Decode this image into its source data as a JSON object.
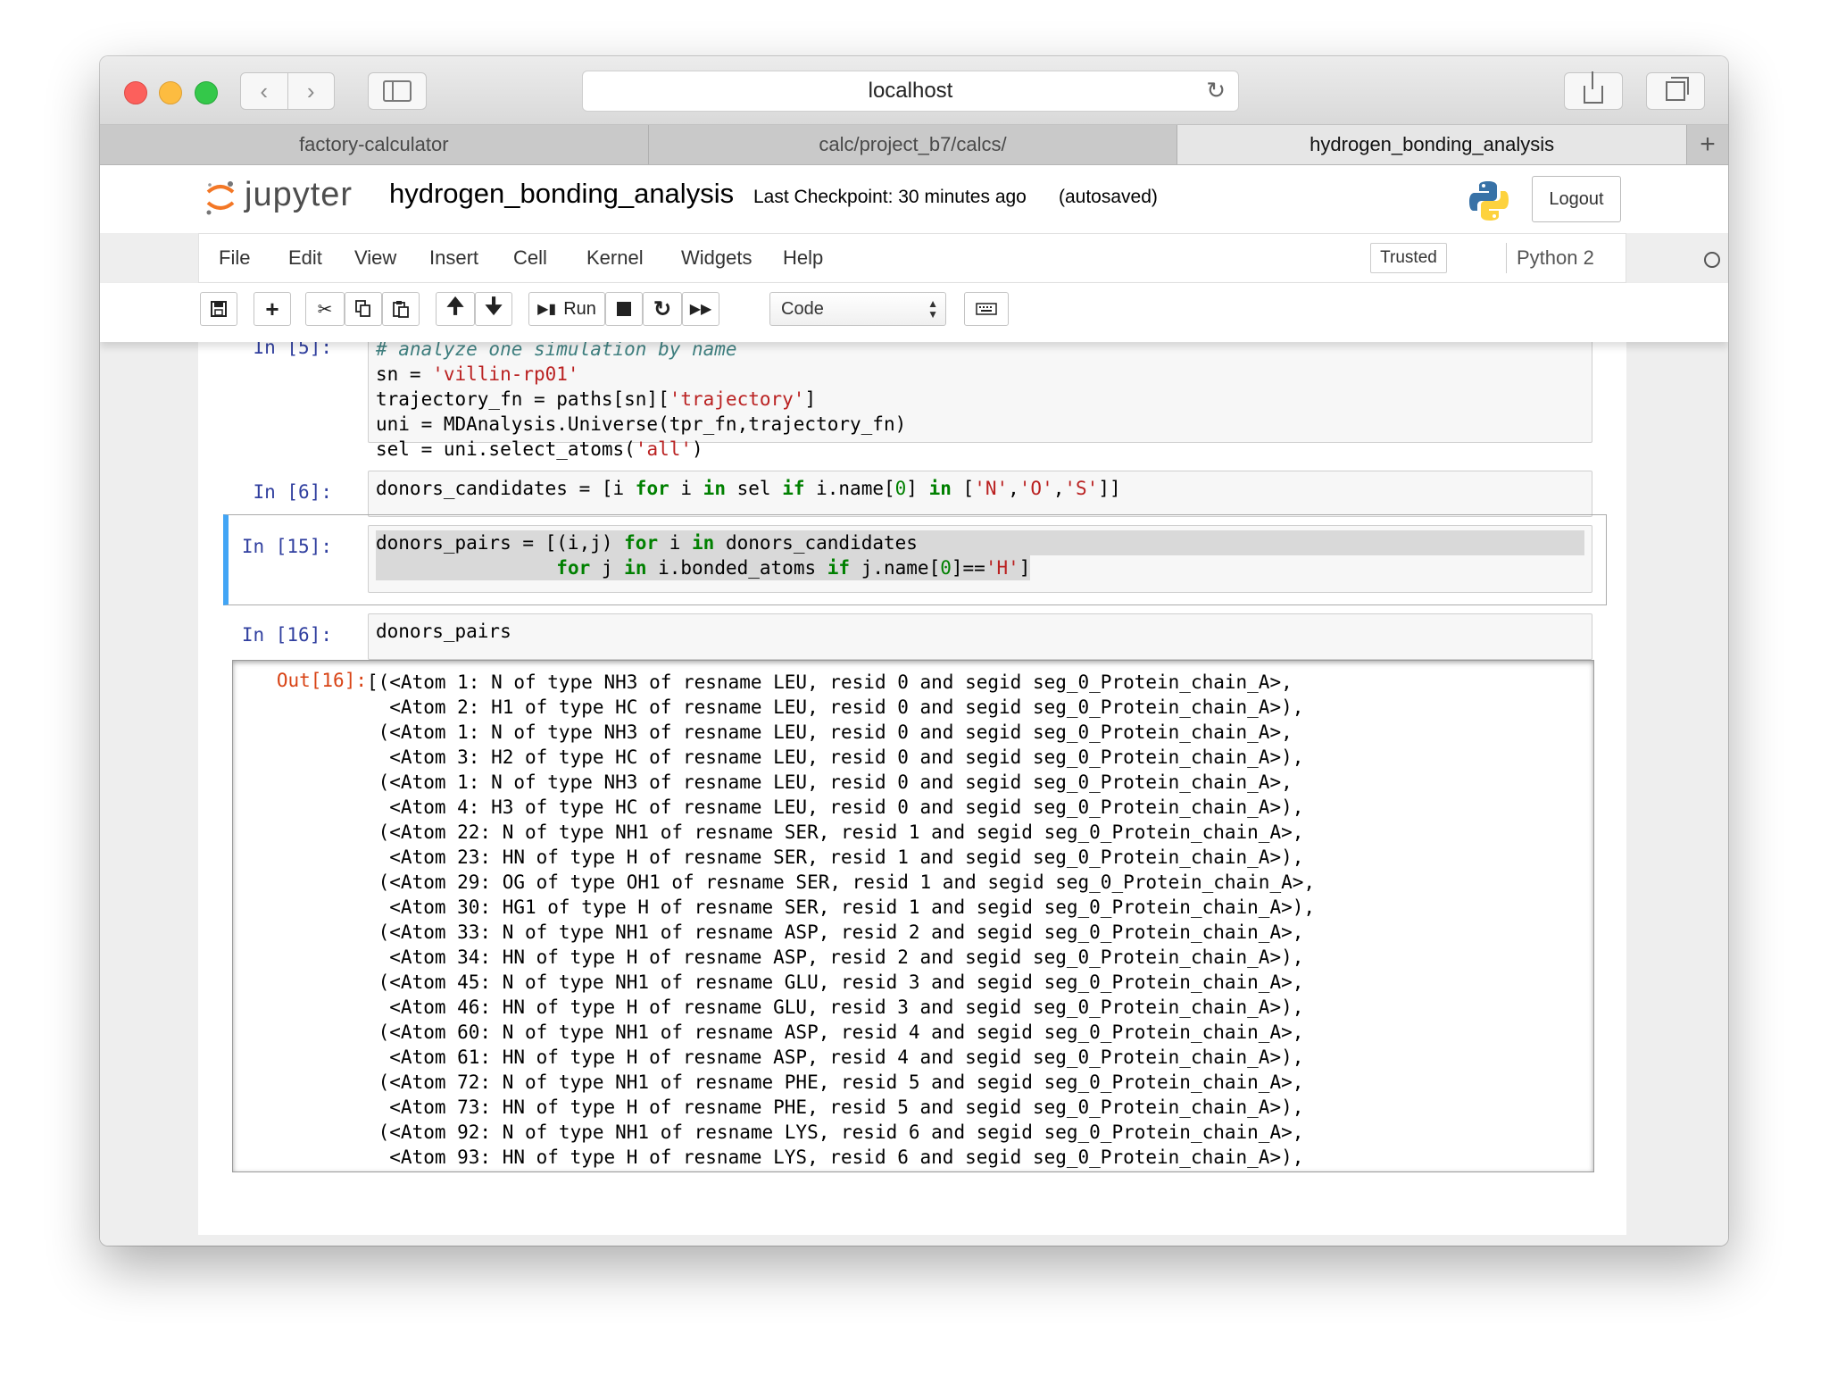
{
  "browser": {
    "address": "localhost",
    "tabs": [
      "factory-calculator",
      "calc/project_b7/calcs/",
      "hydrogen_bonding_analysis"
    ],
    "new_tab": "+"
  },
  "jupyter": {
    "logo_text": "jupyter",
    "notebook_title": "hydrogen_bonding_analysis",
    "checkpoint": "Last Checkpoint: 30 minutes ago",
    "autosave_status": "(autosaved)",
    "logout_label": "Logout",
    "menu": [
      "File",
      "Edit",
      "View",
      "Insert",
      "Cell",
      "Kernel",
      "Widgets",
      "Help"
    ],
    "trusted_label": "Trusted",
    "kernel_name": "Python 2",
    "toolbar": {
      "run_label": "Run",
      "cell_type": "Code"
    }
  },
  "cells": {
    "cell0": {
      "prompt": "In [5]:",
      "lines": [
        "# analyze one simulation by name",
        "sn = 'villin-rp01'",
        "trajectory_fn = paths[sn]['trajectory']",
        "uni = MDAnalysis.Universe(tpr_fn,trajectory_fn)",
        "sel = uni.select_atoms('all')"
      ]
    },
    "cell1": {
      "prompt": "In [6]:",
      "code": "donors_candidates = [i for i in sel if i.name[0] in ['N','O','S']]"
    },
    "cell2": {
      "prompt": "In [15]:",
      "line1": "donors_pairs = [(i,j) for i in donors_candidates",
      "line2": "                for j in i.bonded_atoms if j.name[0]=='H']"
    },
    "cell3": {
      "prompt": "In [16]:",
      "code": "donors_pairs",
      "out_prompt": "Out[16]:",
      "output_lines": [
        "[(<Atom 1: N of type NH3 of resname LEU, resid 0 and segid seg_0_Protein_chain_A>,",
        "  <Atom 2: H1 of type HC of resname LEU, resid 0 and segid seg_0_Protein_chain_A>),",
        " (<Atom 1: N of type NH3 of resname LEU, resid 0 and segid seg_0_Protein_chain_A>,",
        "  <Atom 3: H2 of type HC of resname LEU, resid 0 and segid seg_0_Protein_chain_A>),",
        " (<Atom 1: N of type NH3 of resname LEU, resid 0 and segid seg_0_Protein_chain_A>,",
        "  <Atom 4: H3 of type HC of resname LEU, resid 0 and segid seg_0_Protein_chain_A>),",
        " (<Atom 22: N of type NH1 of resname SER, resid 1 and segid seg_0_Protein_chain_A>,",
        "  <Atom 23: HN of type H of resname SER, resid 1 and segid seg_0_Protein_chain_A>),",
        " (<Atom 29: OG of type OH1 of resname SER, resid 1 and segid seg_0_Protein_chain_A>,",
        "  <Atom 30: HG1 of type H of resname SER, resid 1 and segid seg_0_Protein_chain_A>),",
        " (<Atom 33: N of type NH1 of resname ASP, resid 2 and segid seg_0_Protein_chain_A>,",
        "  <Atom 34: HN of type H of resname ASP, resid 2 and segid seg_0_Protein_chain_A>),",
        " (<Atom 45: N of type NH1 of resname GLU, resid 3 and segid seg_0_Protein_chain_A>,",
        "  <Atom 46: HN of type H of resname GLU, resid 3 and segid seg_0_Protein_chain_A>),",
        " (<Atom 60: N of type NH1 of resname ASP, resid 4 and segid seg_0_Protein_chain_A>,",
        "  <Atom 61: HN of type H of resname ASP, resid 4 and segid seg_0_Protein_chain_A>),",
        " (<Atom 72: N of type NH1 of resname PHE, resid 5 and segid seg_0_Protein_chain_A>,",
        "  <Atom 73: HN of type H of resname PHE, resid 5 and segid seg_0_Protein_chain_A>),",
        " (<Atom 92: N of type NH1 of resname LYS, resid 6 and segid seg_0_Protein_chain_A>,",
        "  <Atom 93: HN of type H of resname LYS, resid 6 and segid seg_0_Protein_chain_A>),"
      ]
    }
  },
  "colors": {
    "prompt_in": "#303f9f",
    "prompt_out": "#d84315",
    "keyword": "#008000",
    "string": "#ba2121",
    "selected_border": "#42a5f5"
  },
  "icons": {
    "toolbar": [
      "save-icon",
      "plus-icon",
      "cut-icon",
      "copy-icon",
      "paste-icon",
      "arrow-up-icon",
      "arrow-down-icon",
      "step-forward-icon",
      "stop-icon",
      "restart-icon",
      "fast-forward-icon",
      "keyboard-icon"
    ]
  }
}
